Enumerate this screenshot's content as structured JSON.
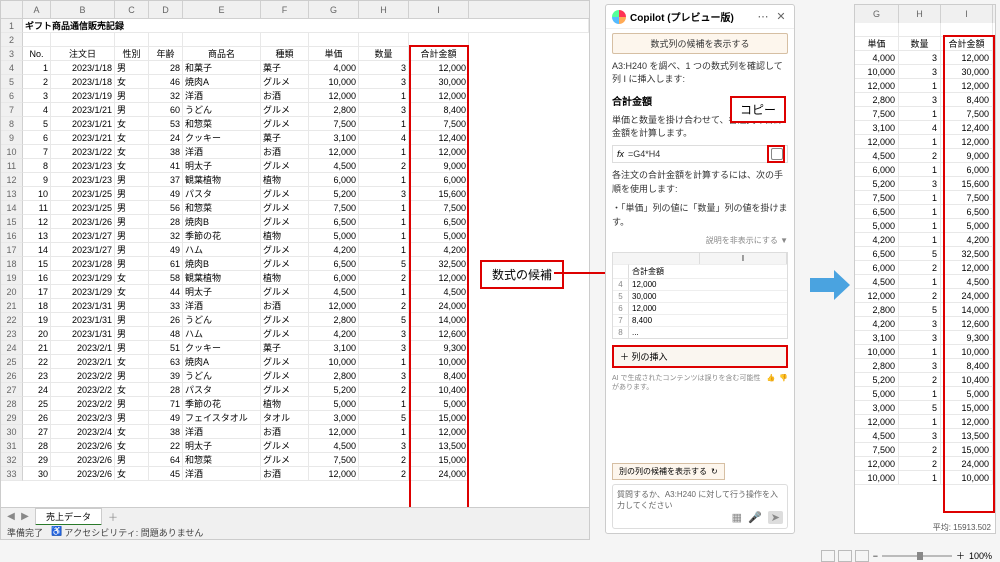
{
  "title": "ギフト商品通信販売記録",
  "columns": [
    "A",
    "B",
    "C",
    "D",
    "E",
    "F",
    "G",
    "H",
    "I"
  ],
  "headers": {
    "A": "No.",
    "B": "注文日",
    "C": "性別",
    "D": "年齢",
    "E": "商品名",
    "F": "種類",
    "G": "単価",
    "H": "数量",
    "I": "合計金額"
  },
  "rows": [
    {
      "r": 4,
      "no": 1,
      "date": "2023/1/18",
      "sex": "男",
      "age": 28,
      "prod": "和菓子",
      "cat": "菓子",
      "price": "4,000",
      "qty": "3",
      "total": "12,000"
    },
    {
      "r": 5,
      "no": 2,
      "date": "2023/1/18",
      "sex": "女",
      "age": 46,
      "prod": "焼肉A",
      "cat": "グルメ",
      "price": "10,000",
      "qty": "3",
      "total": "30,000"
    },
    {
      "r": 6,
      "no": 3,
      "date": "2023/1/19",
      "sex": "男",
      "age": 32,
      "prod": "洋酒",
      "cat": "お酒",
      "price": "12,000",
      "qty": "1",
      "total": "12,000"
    },
    {
      "r": 7,
      "no": 4,
      "date": "2023/1/21",
      "sex": "男",
      "age": 60,
      "prod": "うどん",
      "cat": "グルメ",
      "price": "2,800",
      "qty": "3",
      "total": "8,400"
    },
    {
      "r": 8,
      "no": 5,
      "date": "2023/1/21",
      "sex": "女",
      "age": 53,
      "prod": "和惣菜",
      "cat": "グルメ",
      "price": "7,500",
      "qty": "1",
      "total": "7,500"
    },
    {
      "r": 9,
      "no": 6,
      "date": "2023/1/21",
      "sex": "女",
      "age": 24,
      "prod": "クッキー",
      "cat": "菓子",
      "price": "3,100",
      "qty": "4",
      "total": "12,400"
    },
    {
      "r": 10,
      "no": 7,
      "date": "2023/1/22",
      "sex": "女",
      "age": 38,
      "prod": "洋酒",
      "cat": "お酒",
      "price": "12,000",
      "qty": "1",
      "total": "12,000"
    },
    {
      "r": 11,
      "no": 8,
      "date": "2023/1/23",
      "sex": "女",
      "age": 41,
      "prod": "明太子",
      "cat": "グルメ",
      "price": "4,500",
      "qty": "2",
      "total": "9,000"
    },
    {
      "r": 12,
      "no": 9,
      "date": "2023/1/23",
      "sex": "男",
      "age": 37,
      "prod": "観葉植物",
      "cat": "植物",
      "price": "6,000",
      "qty": "1",
      "total": "6,000"
    },
    {
      "r": 13,
      "no": 10,
      "date": "2023/1/25",
      "sex": "男",
      "age": 49,
      "prod": "パスタ",
      "cat": "グルメ",
      "price": "5,200",
      "qty": "3",
      "total": "15,600"
    },
    {
      "r": 14,
      "no": 11,
      "date": "2023/1/25",
      "sex": "男",
      "age": 56,
      "prod": "和惣菜",
      "cat": "グルメ",
      "price": "7,500",
      "qty": "1",
      "total": "7,500"
    },
    {
      "r": 15,
      "no": 12,
      "date": "2023/1/26",
      "sex": "男",
      "age": 28,
      "prod": "焼肉B",
      "cat": "グルメ",
      "price": "6,500",
      "qty": "1",
      "total": "6,500"
    },
    {
      "r": 16,
      "no": 13,
      "date": "2023/1/27",
      "sex": "男",
      "age": 32,
      "prod": "季節の花",
      "cat": "植物",
      "price": "5,000",
      "qty": "1",
      "total": "5,000"
    },
    {
      "r": 17,
      "no": 14,
      "date": "2023/1/27",
      "sex": "男",
      "age": 49,
      "prod": "ハム",
      "cat": "グルメ",
      "price": "4,200",
      "qty": "1",
      "total": "4,200"
    },
    {
      "r": 18,
      "no": 15,
      "date": "2023/1/28",
      "sex": "男",
      "age": 61,
      "prod": "焼肉B",
      "cat": "グルメ",
      "price": "6,500",
      "qty": "5",
      "total": "32,500"
    },
    {
      "r": 19,
      "no": 16,
      "date": "2023/1/29",
      "sex": "女",
      "age": 58,
      "prod": "観葉植物",
      "cat": "植物",
      "price": "6,000",
      "qty": "2",
      "total": "12,000"
    },
    {
      "r": 20,
      "no": 17,
      "date": "2023/1/29",
      "sex": "女",
      "age": 44,
      "prod": "明太子",
      "cat": "グルメ",
      "price": "4,500",
      "qty": "1",
      "total": "4,500"
    },
    {
      "r": 21,
      "no": 18,
      "date": "2023/1/31",
      "sex": "男",
      "age": 33,
      "prod": "洋酒",
      "cat": "お酒",
      "price": "12,000",
      "qty": "2",
      "total": "24,000"
    },
    {
      "r": 22,
      "no": 19,
      "date": "2023/1/31",
      "sex": "男",
      "age": 26,
      "prod": "うどん",
      "cat": "グルメ",
      "price": "2,800",
      "qty": "5",
      "total": "14,000"
    },
    {
      "r": 23,
      "no": 20,
      "date": "2023/1/31",
      "sex": "男",
      "age": 48,
      "prod": "ハム",
      "cat": "グルメ",
      "price": "4,200",
      "qty": "3",
      "total": "12,600"
    },
    {
      "r": 24,
      "no": 21,
      "date": "2023/2/1",
      "sex": "男",
      "age": 51,
      "prod": "クッキー",
      "cat": "菓子",
      "price": "3,100",
      "qty": "3",
      "total": "9,300"
    },
    {
      "r": 25,
      "no": 22,
      "date": "2023/2/1",
      "sex": "女",
      "age": 63,
      "prod": "焼肉A",
      "cat": "グルメ",
      "price": "10,000",
      "qty": "1",
      "total": "10,000"
    },
    {
      "r": 26,
      "no": 23,
      "date": "2023/2/2",
      "sex": "男",
      "age": 39,
      "prod": "うどん",
      "cat": "グルメ",
      "price": "2,800",
      "qty": "3",
      "total": "8,400"
    },
    {
      "r": 27,
      "no": 24,
      "date": "2023/2/2",
      "sex": "女",
      "age": 28,
      "prod": "パスタ",
      "cat": "グルメ",
      "price": "5,200",
      "qty": "2",
      "total": "10,400"
    },
    {
      "r": 28,
      "no": 25,
      "date": "2023/2/2",
      "sex": "男",
      "age": 71,
      "prod": "季節の花",
      "cat": "植物",
      "price": "5,000",
      "qty": "1",
      "total": "5,000"
    },
    {
      "r": 29,
      "no": 26,
      "date": "2023/2/3",
      "sex": "男",
      "age": 49,
      "prod": "フェイスタオル",
      "cat": "タオル",
      "price": "3,000",
      "qty": "5",
      "total": "15,000"
    },
    {
      "r": 30,
      "no": 27,
      "date": "2023/2/4",
      "sex": "女",
      "age": 38,
      "prod": "洋酒",
      "cat": "お酒",
      "price": "12,000",
      "qty": "1",
      "total": "12,000"
    },
    {
      "r": 31,
      "no": 28,
      "date": "2023/2/6",
      "sex": "女",
      "age": 22,
      "prod": "明太子",
      "cat": "グルメ",
      "price": "4,500",
      "qty": "3",
      "total": "13,500"
    },
    {
      "r": 32,
      "no": 29,
      "date": "2023/2/6",
      "sex": "男",
      "age": 64,
      "prod": "和惣菜",
      "cat": "グルメ",
      "price": "7,500",
      "qty": "2",
      "total": "15,000"
    },
    {
      "r": 33,
      "no": 30,
      "date": "2023/2/6",
      "sex": "女",
      "age": 45,
      "prod": "洋酒",
      "cat": "お酒",
      "price": "12,000",
      "qty": "2",
      "total": "24,000"
    }
  ],
  "sheet_tab": "売上データ",
  "status": {
    "ready": "準備完了",
    "acc": "アクセシビリティ: 問題ありません",
    "zoom": "100%"
  },
  "callout": {
    "formula": "数式の候補",
    "copy": "コピー"
  },
  "copilot": {
    "title": "Copilot (プレビュー版)",
    "chip": "数式列の候補を表示する",
    "msg1": "A3:H240 を調べ、1 つの数式列を確認して 列 I に挿入します:",
    "heading": "合計金額",
    "desc": "単価と数量を掛け合わせて、各注文の合計金額を計算します。",
    "fx": "=G4*H4",
    "note": "各注文の合計金額を計算するには、次の手順を使用します:",
    "bullet": "・「単価」列の値に「数量」列の値を掛けます。",
    "subnote": "説明を非表示にする ▼",
    "preview_head": "合計金額",
    "preview": [
      {
        "n": "4",
        "v": "12,000"
      },
      {
        "n": "5",
        "v": "30,000"
      },
      {
        "n": "6",
        "v": "12,000"
      },
      {
        "n": "7",
        "v": "8,400"
      },
      {
        "n": "8",
        "v": "..."
      }
    ],
    "insert": "＋ 列の挿入",
    "disclaimer": "AI で生成されたコンテンツは誤りを含む可能性があります。",
    "alt_chip": "別の列の候補を表示する",
    "ask": "質問するか、A3:H240 に対して行う操作を入力してください"
  },
  "right": {
    "cols": [
      "G",
      "H",
      "I"
    ],
    "headers": {
      "G": "単価",
      "H": "数量",
      "I": "合計金額"
    },
    "rows": [
      [
        "4,000",
        "3",
        "12,000"
      ],
      [
        "10,000",
        "3",
        "30,000"
      ],
      [
        "12,000",
        "1",
        "12,000"
      ],
      [
        "2,800",
        "3",
        "8,400"
      ],
      [
        "7,500",
        "1",
        "7,500"
      ],
      [
        "3,100",
        "4",
        "12,400"
      ],
      [
        "12,000",
        "1",
        "12,000"
      ],
      [
        "4,500",
        "2",
        "9,000"
      ],
      [
        "6,000",
        "1",
        "6,000"
      ],
      [
        "5,200",
        "3",
        "15,600"
      ],
      [
        "7,500",
        "1",
        "7,500"
      ],
      [
        "6,500",
        "1",
        "6,500"
      ],
      [
        "5,000",
        "1",
        "5,000"
      ],
      [
        "4,200",
        "1",
        "4,200"
      ],
      [
        "6,500",
        "5",
        "32,500"
      ],
      [
        "6,000",
        "2",
        "12,000"
      ],
      [
        "4,500",
        "1",
        "4,500"
      ],
      [
        "12,000",
        "2",
        "24,000"
      ],
      [
        "2,800",
        "5",
        "14,000"
      ],
      [
        "4,200",
        "3",
        "12,600"
      ],
      [
        "3,100",
        "3",
        "9,300"
      ],
      [
        "10,000",
        "1",
        "10,000"
      ],
      [
        "2,800",
        "3",
        "8,400"
      ],
      [
        "5,200",
        "2",
        "10,400"
      ],
      [
        "5,000",
        "1",
        "5,000"
      ],
      [
        "3,000",
        "5",
        "15,000"
      ],
      [
        "12,000",
        "1",
        "12,000"
      ],
      [
        "4,500",
        "3",
        "13,500"
      ],
      [
        "7,500",
        "2",
        "15,000"
      ],
      [
        "12,000",
        "2",
        "24,000"
      ],
      [
        "10,000",
        "1",
        "10,000"
      ]
    ],
    "avg": "平均: 15913.502"
  }
}
